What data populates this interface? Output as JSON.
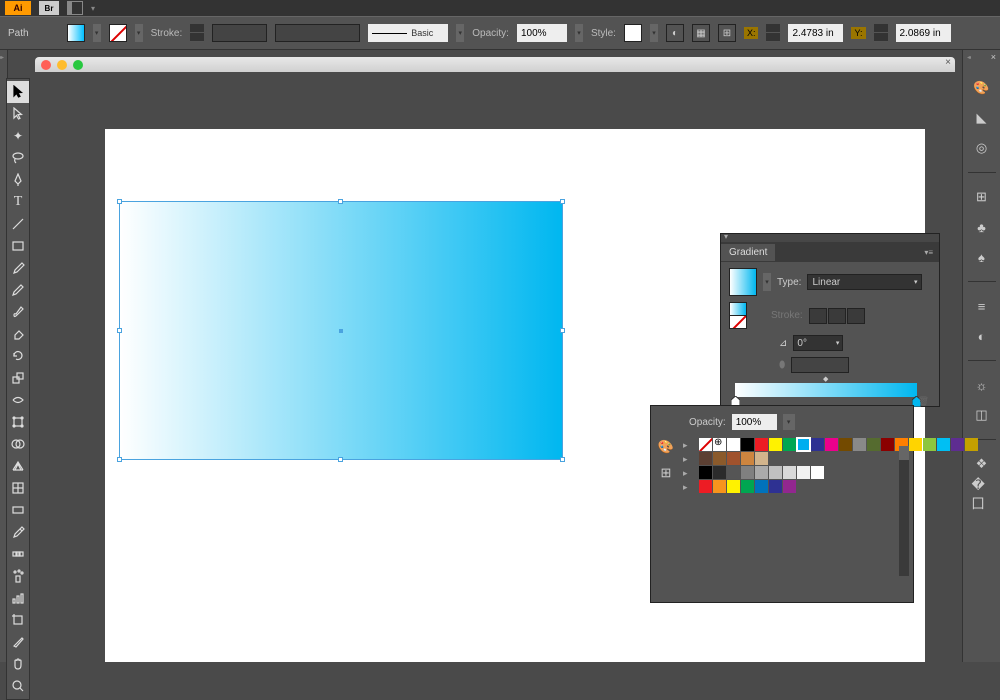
{
  "app": {
    "logo": "Ai",
    "bridge": "Br"
  },
  "control_bar": {
    "selection": "Path",
    "stroke_label": "Stroke:",
    "brush_label": "Basic",
    "opacity_label": "Opacity:",
    "opacity_value": "100%",
    "style_label": "Style:",
    "x_label": "X:",
    "x_value": "2.4783 in",
    "y_label": "Y:",
    "y_value": "2.0869 in"
  },
  "tools": [
    "selection",
    "direct-selection",
    "magic-wand",
    "lasso",
    "pen",
    "type",
    "line",
    "rectangle",
    "paintbrush",
    "pencil",
    "blob-brush",
    "eraser",
    "rotate",
    "scale",
    "width",
    "free-transform",
    "shape-builder",
    "perspective-grid",
    "mesh",
    "gradient",
    "eyedropper",
    "blend",
    "symbol-sprayer",
    "column-graph",
    "artboard",
    "slice",
    "hand",
    "zoom"
  ],
  "gradient_panel": {
    "title": "Gradient",
    "type_label": "Type:",
    "type_value": "Linear",
    "stroke_label": "Stroke:",
    "angle_value": "0°"
  },
  "swatches_panel": {
    "opacity_label": "Opacity:",
    "opacity_value": "100%",
    "row1": [
      "none",
      "reg",
      "#ffffff",
      "#000000",
      "#ed1c24",
      "#fff200",
      "#00a651",
      "#00aeef",
      "#2e3192",
      "#ec008c",
      "#734a00",
      "#898989",
      "#556b2f",
      "#8b0000",
      "#ff7f00",
      "#ffd400",
      "#8dc63e",
      "#00bff3",
      "#5e2d91",
      "#c4a000"
    ],
    "row2": [
      "#5c4033",
      "#8b5a2b",
      "#a0522d",
      "#cd853f",
      "#d2b48c"
    ],
    "row3": [
      "#000000",
      "#2b2b2b",
      "#555555",
      "#808080",
      "#aaaaaa",
      "#c0c0c0",
      "#d9d9d9",
      "#f2f2f2",
      "#ffffff"
    ],
    "row4": [
      "#ed1c24",
      "#f7941d",
      "#fff200",
      "#00a651",
      "#0072bc",
      "#2e3192",
      "#92278f"
    ]
  },
  "dock_icons": [
    "color",
    "color-guide",
    "swatches",
    "brushes",
    "symbols",
    "stroke",
    "gradient",
    "transparency",
    "appearance",
    "graphic-styles",
    "layers",
    "artboards"
  ]
}
